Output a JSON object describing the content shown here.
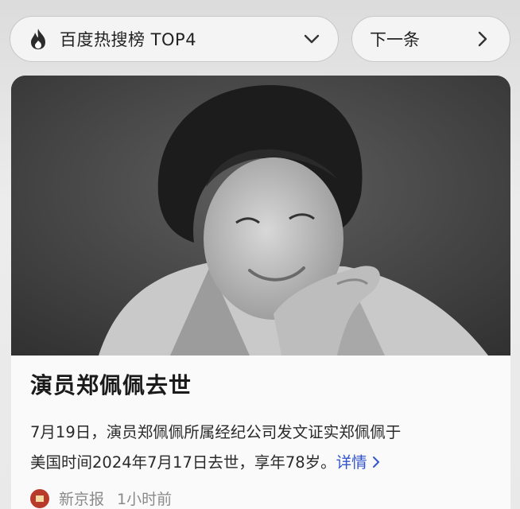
{
  "hot_list": {
    "title": "百度热搜榜 TOP4",
    "icon": "flame-icon",
    "dropdown_icon": "chevron-down-icon"
  },
  "next": {
    "label": "下一条",
    "icon": "chevron-right-icon"
  },
  "card": {
    "image": "portrait-photo",
    "headline": "演员郑佩佩去世",
    "summary_line1": "7月19日，演员郑佩佩所属经纪公司发文证实郑佩佩于",
    "summary_line2": "美国时间2024年7月17日去世，享年78岁。",
    "more_label": "详情",
    "source": "新京报",
    "time": "1小时前"
  },
  "colors": {
    "link": "#3355cc",
    "source_logo": "#b83a2b"
  }
}
